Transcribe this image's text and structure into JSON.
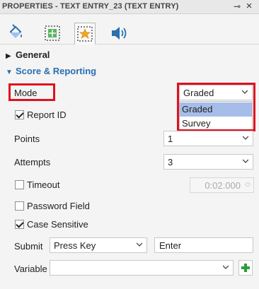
{
  "panel": {
    "title": "PROPERTIES - TEXT ENTRY_23 (TEXT ENTRY)",
    "pin_icon": "pin-icon",
    "close_icon": "close-icon"
  },
  "tabs": [
    {
      "name": "fill-style",
      "icon": "paint-bucket-icon"
    },
    {
      "name": "size-position",
      "icon": "resize-icon"
    },
    {
      "name": "interaction",
      "icon": "star-interaction-icon",
      "active": true
    },
    {
      "name": "audio",
      "icon": "speaker-icon"
    }
  ],
  "sections": {
    "general": "General",
    "score_reporting": "Score & Reporting"
  },
  "fields": {
    "mode": {
      "label": "Mode",
      "value": "Graded",
      "options": [
        "Graded",
        "Survey"
      ],
      "highlighted_option": "Graded"
    },
    "report_id": {
      "label": "Report ID",
      "checked": true
    },
    "points": {
      "label": "Points",
      "value": "1"
    },
    "attempts": {
      "label": "Attempts",
      "value": "3"
    },
    "timeout": {
      "label": "Timeout",
      "checked": false,
      "value": "0:02.000"
    },
    "password_field": {
      "label": "Password Field",
      "checked": false
    },
    "case_sensitive": {
      "label": "Case Sensitive",
      "checked": true
    },
    "submit": {
      "label": "Submit",
      "trigger": "Press Key",
      "key": "Enter"
    },
    "variable": {
      "label": "Variable",
      "value": ""
    }
  },
  "colors": {
    "highlight": "#e0101e",
    "section_accent": "#2a6fb0",
    "selected_option": "#a5bde8",
    "add_icon": "#2f9d3a"
  }
}
